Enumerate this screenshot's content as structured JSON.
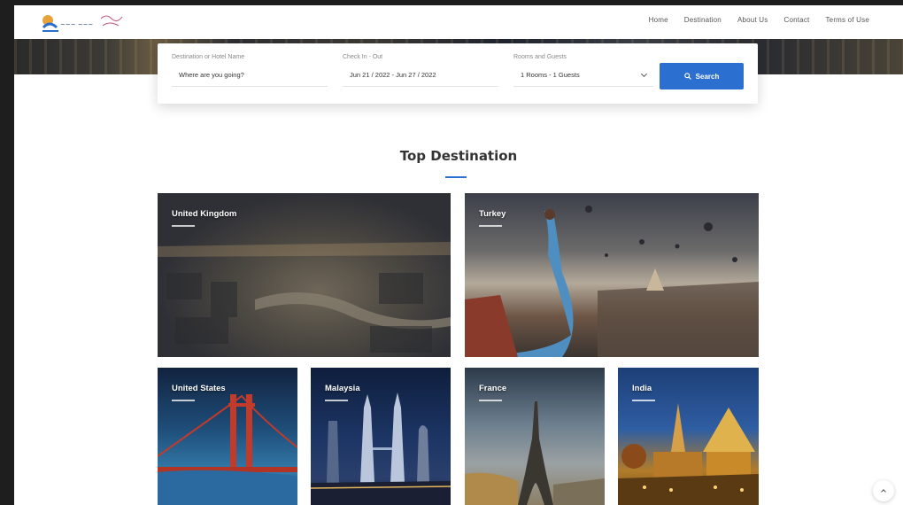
{
  "header": {
    "logo_name": "travel-logo",
    "nav": [
      "Home",
      "Destination",
      "About Us",
      "Contact",
      "Terms of Use"
    ]
  },
  "search": {
    "destination_label": "Destination or Hotel Name",
    "destination_placeholder": "Where are you going?",
    "dates_label": "Check In - Out",
    "dates_value": "Jun 21 / 2022 - Jun 27 / 2022",
    "guests_label": "Rooms and Guests",
    "guests_value": "1 Rooms - 1 Guests",
    "button_label": "Search",
    "button_color": "#2b6fd1"
  },
  "section": {
    "title": "Top Destination"
  },
  "destinations": [
    {
      "name": "United Kingdom"
    },
    {
      "name": "Turkey"
    },
    {
      "name": "United States"
    },
    {
      "name": "Malaysia"
    },
    {
      "name": "France"
    },
    {
      "name": "India"
    }
  ]
}
